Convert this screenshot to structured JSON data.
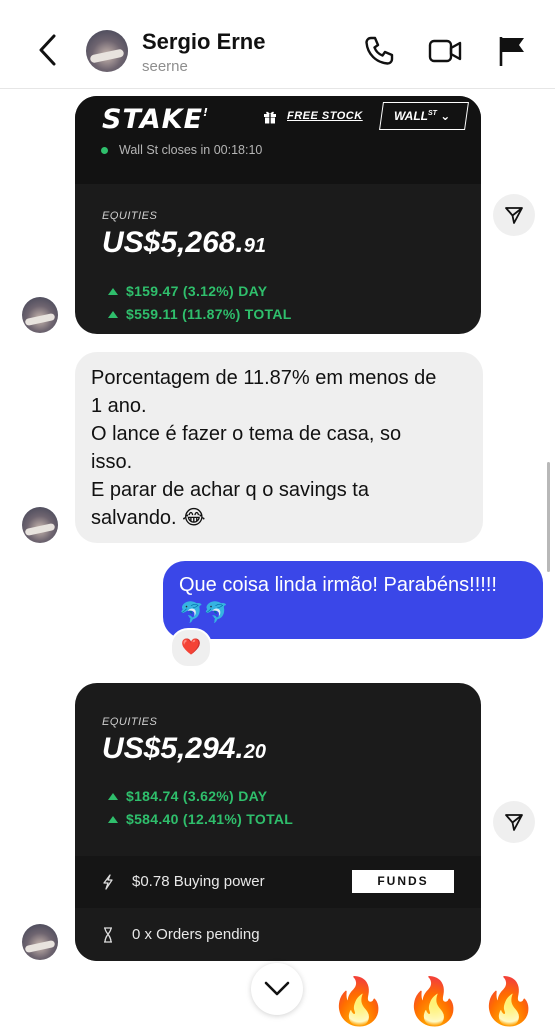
{
  "header": {
    "name": "Sergio Erne",
    "handle": "seerne"
  },
  "card1": {
    "brand": "STAKE",
    "brand_mark": "!",
    "free_stock": "FREE STOCK",
    "market_button": "WALL",
    "market_sup": "ST",
    "market_status": "Wall St closes in 00:18:10",
    "equities_label": "EQUITIES",
    "value_main": "US$5,268.",
    "value_cents": "91",
    "day_gain": "$159.47 (3.12%) DAY",
    "total_gain": "$559.11 (11.87%) TOTAL"
  },
  "message_in": {
    "lines": [
      "Porcentagem de 11.87% em menos de",
      "1 ano.",
      "O lance é fazer o tema de casa, so",
      "isso.",
      "E parar de achar q o savings ta",
      "salvando. 😂"
    ]
  },
  "message_out": {
    "text": "Que coisa linda irmão! Parabéns!!!!!",
    "emojis": "🐬🐬",
    "reaction": "❤️"
  },
  "card2": {
    "equities_label": "EQUITIES",
    "value_main": "US$5,294.",
    "value_cents": "20",
    "day_gain": "$184.74 (3.62%) DAY",
    "total_gain": "$584.40 (12.41%) TOTAL",
    "buying_power": "$0.78 Buying power",
    "funds_button": "FUNDS",
    "orders_pending": "0 x Orders pending"
  },
  "footer": {
    "fire_emoji": "🔥"
  },
  "colors": {
    "accent_blue": "#3a47e8",
    "gain_green": "#2fbf6c",
    "card_bg": "#1b1b1b"
  }
}
